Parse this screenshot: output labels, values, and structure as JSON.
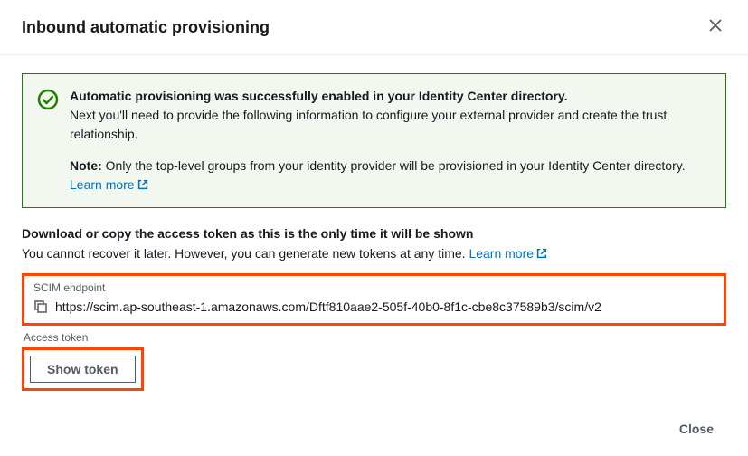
{
  "header": {
    "title": "Inbound automatic provisioning"
  },
  "success": {
    "title": "Automatic provisioning was successfully enabled in your Identity Center directory.",
    "text": "Next you'll need to provide the following information to configure your external provider and create the trust relationship.",
    "note_label": "Note:",
    "note_text": " Only the top-level groups from your identity provider will be provisioned in your Identity Center directory. ",
    "learn_more": "Learn more"
  },
  "download": {
    "heading": "Download or copy the access token as this is the only time it will be shown",
    "text": "You cannot recover it later. However, you can generate new tokens at any time. ",
    "learn_more": "Learn more"
  },
  "scim": {
    "label": "SCIM endpoint",
    "value": "https://scim.ap-southeast-1.amazonaws.com/Dftf810aae2-505f-40b0-8f1c-cbe8c37589b3/scim/v2"
  },
  "access_token": {
    "label": "Access token",
    "button": "Show token"
  },
  "footer": {
    "close": "Close"
  }
}
